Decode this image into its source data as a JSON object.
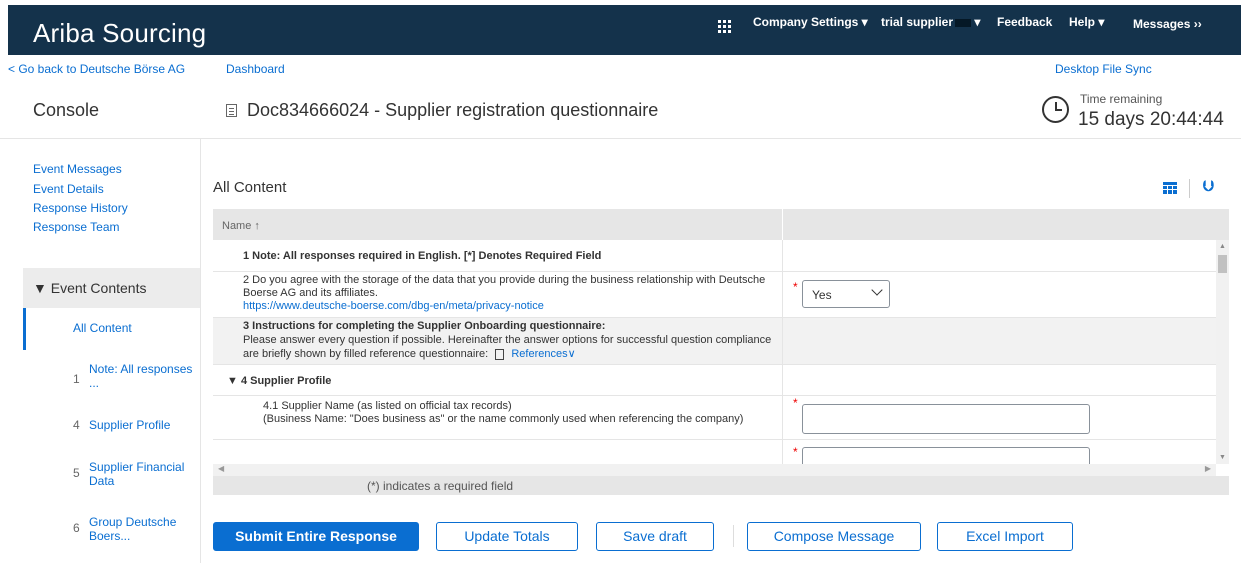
{
  "header": {
    "brand": "Ariba Sourcing",
    "nav": [
      "Company Settings ▾",
      "trial supplier",
      "Feedback",
      "Help ▾",
      "Messages ››"
    ]
  },
  "subnav": {
    "back": "< Go back to Deutsche Börse AG",
    "dashboard": "Dashboard",
    "desktop_sync": "Desktop File Sync"
  },
  "console": {
    "title": "Console",
    "doc_title": "Doc834666024 - Supplier registration questionnaire",
    "time_label": "Time remaining",
    "time_value": "15 days 20:44:44"
  },
  "sidebar": {
    "links": [
      "Event Messages",
      "Event Details",
      "Response History",
      "Response Team"
    ],
    "event_contents": "▼ Event Contents",
    "all_content": "All Content",
    "items": [
      {
        "num": "1",
        "label": "Note: All responses ..."
      },
      {
        "num": "4",
        "label": "Supplier Profile"
      },
      {
        "num": "5",
        "label": "Supplier Financial Data"
      },
      {
        "num": "6",
        "label": "Group Deutsche Boers..."
      }
    ]
  },
  "main": {
    "title": "All Content",
    "column_name": "Name ↑",
    "rows": {
      "r1": "1  Note: All responses required in English. [*] Denotes Required Field",
      "r2_text": "2  Do you agree with the storage of the data that you provide during the business relationship with Deutsche Boerse AG and its affiliates.",
      "r2_link": "https://www.deutsche-boerse.com/dbg-en/meta/privacy-notice",
      "r2_value": "Yes",
      "r3_title": "3  Instructions for completing the Supplier Onboarding questionnaire:",
      "r3_text": "Please answer every question if possible. Hereinafter the answer options for successful question compliance are briefly shown by filled reference questionnaire:",
      "r3_ref": "References",
      "r4": "▼ 4  Supplier Profile",
      "r41": "4.1  Supplier Name (as listed on official tax records)\n(Business Name:  \"Does business as\" or the name commonly used when referencing the company)"
    },
    "required_mark": "*",
    "footer_note": "(*) indicates a required field"
  },
  "buttons": {
    "submit": "Submit Entire Response",
    "update": "Update Totals",
    "save": "Save draft",
    "compose": "Compose Message",
    "excel": "Excel Import"
  },
  "colors": {
    "header_bg": "#14324b",
    "accent": "#0a6ed1",
    "required": "#e00000"
  }
}
